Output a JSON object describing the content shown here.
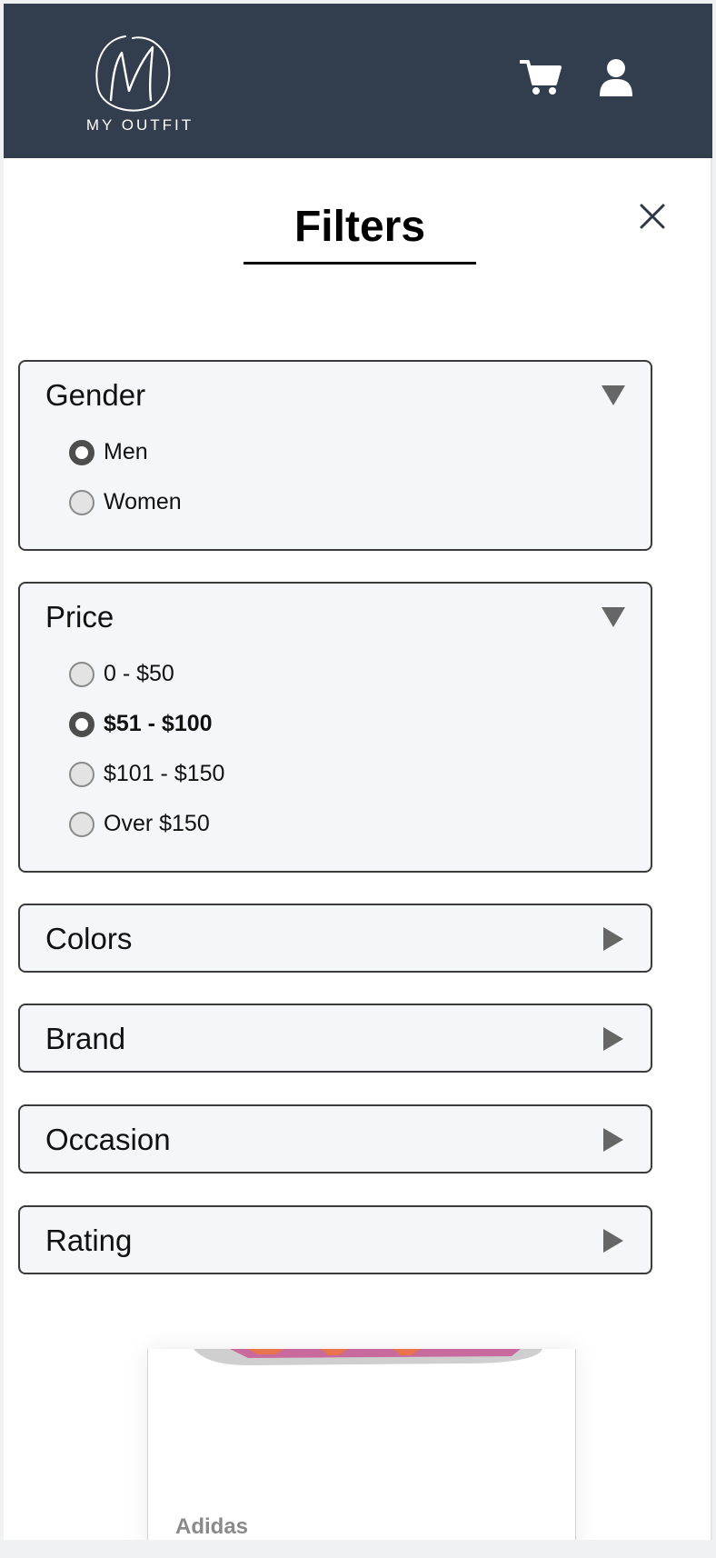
{
  "header": {
    "logo_text": "MY OUTFIT",
    "cart_icon": "cart-icon",
    "user_icon": "user-icon",
    "background": "#323d4e"
  },
  "panel": {
    "title": "Filters",
    "close_icon": "close-icon"
  },
  "filters": {
    "gender": {
      "label": "Gender",
      "expanded": true,
      "options": [
        {
          "label": "Men",
          "selected": true
        },
        {
          "label": "Women",
          "selected": false
        }
      ]
    },
    "price": {
      "label": "Price",
      "expanded": true,
      "options": [
        {
          "label": "0 - $50",
          "selected": false
        },
        {
          "label": "$51 - $100",
          "selected": true
        },
        {
          "label": "$101 - $150",
          "selected": false
        },
        {
          "label": "Over $150",
          "selected": false
        }
      ]
    },
    "colors": {
      "label": "Colors",
      "expanded": false
    },
    "brand": {
      "label": "Brand",
      "expanded": false
    },
    "occasion": {
      "label": "Occasion",
      "expanded": false
    },
    "rating": {
      "label": "Rating",
      "expanded": false
    }
  },
  "product": {
    "brand": "Adidas"
  }
}
